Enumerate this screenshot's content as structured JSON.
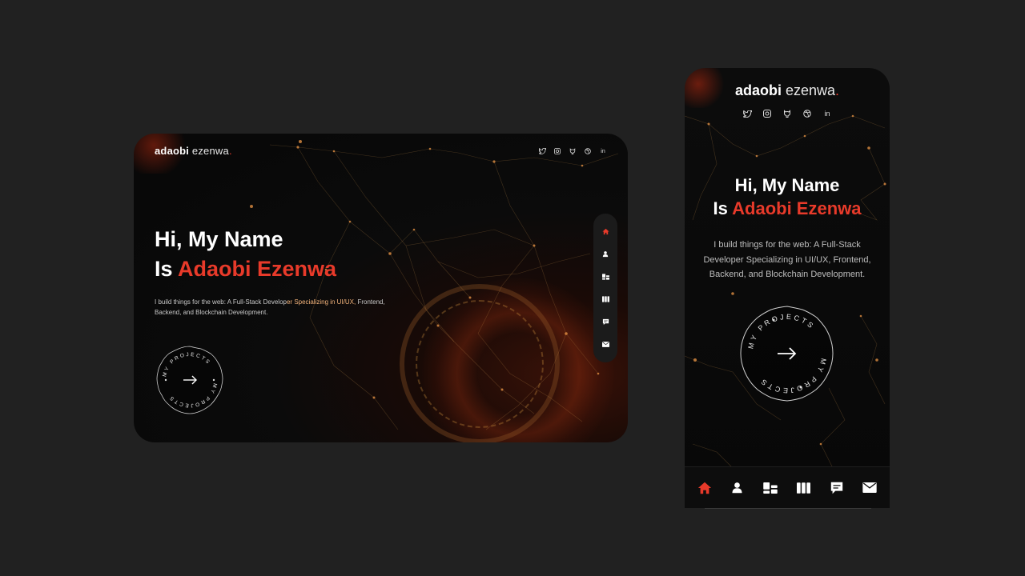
{
  "brand": {
    "first": "adaobi",
    "last": "ezenwa",
    "dot": "."
  },
  "hero": {
    "line1": "Hi, My Name",
    "line2_prefix": "Is ",
    "line2_name": "Adaobi Ezenwa",
    "desc_part1": "I build things for the web: A Full-Stack Develop",
    "desc_highlight": "er Specializing in UI/UX,",
    "desc_part2": " Frontend, Backend, and Blockchain Development.",
    "mobile_desc": "I build things for the web: A Full-Stack Developer Specializing in UI/UX, Frontend, Backend, and Blockchain Development."
  },
  "projects_badge": {
    "label": "MY PROJECTS"
  },
  "social": {
    "desktop": [
      "twitter-icon",
      "instagram-icon",
      "github-icon",
      "dribbble-icon",
      "linkedin-icon"
    ],
    "mobile": [
      "twitter-icon",
      "instagram-icon",
      "github-icon",
      "dribbble-icon",
      "linkedin-icon"
    ],
    "linkedin_glyph": "in"
  },
  "nav": [
    "home-icon",
    "user-icon",
    "services-icon",
    "portfolio-icon",
    "chat-icon",
    "mail-icon"
  ],
  "colors": {
    "accent": "#e83a2a",
    "background": "#212121",
    "panel": "#0b0b0b"
  }
}
